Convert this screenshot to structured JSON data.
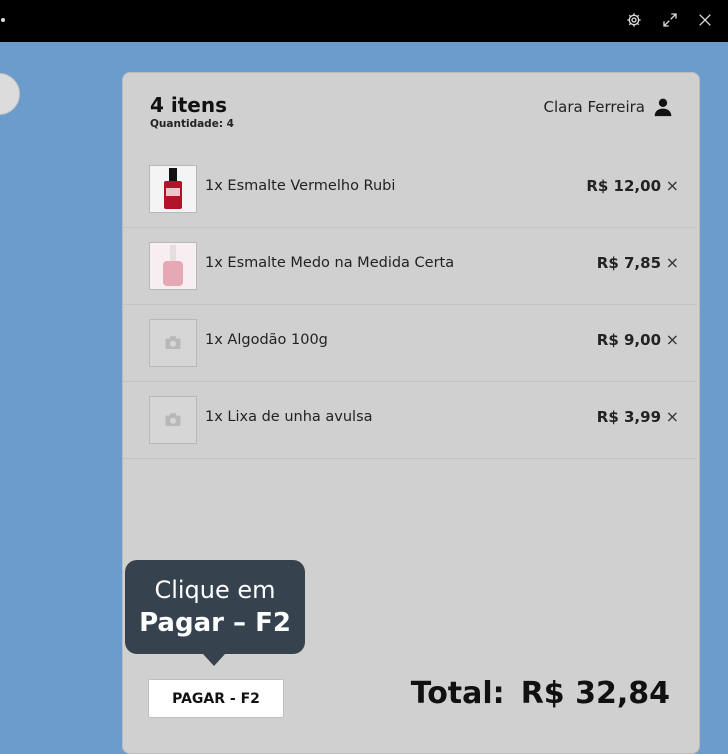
{
  "window": {
    "icons": [
      "gear-icon",
      "expand-icon",
      "close-icon"
    ]
  },
  "cart": {
    "title": "4 itens",
    "quantity_label": "Quantidade: 4",
    "customer_name": "Clara Ferreira",
    "items": [
      {
        "name": "1x Esmalte Vermelho Rubi",
        "price": "R$ 12,00",
        "thumb": "red-nail-polish"
      },
      {
        "name": "1x Esmalte Medo na Medida Certa",
        "price": "R$ 7,85",
        "thumb": "pink-nail-polish"
      },
      {
        "name": "1x Algodão 100g",
        "price": "R$ 9,00",
        "thumb": "camera-placeholder"
      },
      {
        "name": "1x Lixa de unha avulsa",
        "price": "R$ 3,99",
        "thumb": "camera-placeholder"
      }
    ],
    "remove_symbol": "×"
  },
  "tooltip": {
    "line1": "Clique em",
    "line2": "Pagar – F2"
  },
  "footer": {
    "pay_button": "PAGAR - F2",
    "total_label": "Total:",
    "total_value": "R$ 32,84"
  },
  "colors": {
    "background": "#6b9ccb",
    "panel": "#d0d0d0",
    "tooltip": "#36434f",
    "topbar": "#000000"
  }
}
